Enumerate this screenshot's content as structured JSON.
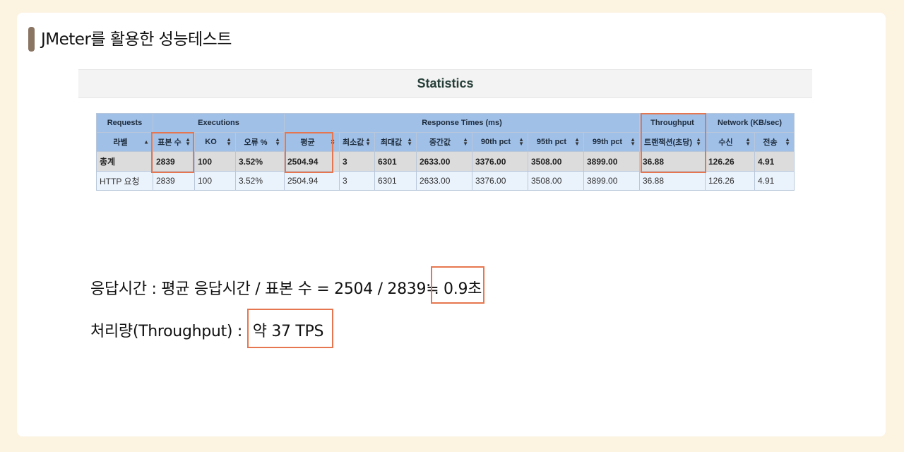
{
  "slide": {
    "title": "JMeter를 활용한 성능테스트"
  },
  "statistics": {
    "title": "Statistics",
    "groups": [
      "Requests",
      "Executions",
      "Response Times (ms)",
      "Throughput",
      "Network (KB/sec)"
    ],
    "columns": [
      "라벨",
      "표본 수",
      "KO",
      "오류 %",
      "평균",
      "최소값",
      "최대값",
      "중간값",
      "90th pct",
      "95th pct",
      "99th pct",
      "트랜잭션(초당)",
      "수신",
      "전송"
    ],
    "rows": [
      [
        "총계",
        "2839",
        "100",
        "3.52%",
        "2504.94",
        "3",
        "6301",
        "2633.00",
        "3376.00",
        "3508.00",
        "3899.00",
        "36.88",
        "126.26",
        "4.91"
      ],
      [
        "HTTP 요청",
        "2839",
        "100",
        "3.52%",
        "2504.94",
        "3",
        "6301",
        "2633.00",
        "3376.00",
        "3508.00",
        "3899.00",
        "36.88",
        "126.26",
        "4.91"
      ]
    ]
  },
  "notes": {
    "line1_prefix": "응답시간 : 평균 응답시간 / 표본 수 = 2504 / 2839",
    "line1_result": "≒ 0.9초",
    "line2_prefix": "처리량(Throughput) : ",
    "line2_result": "약 37 TPS"
  },
  "colors": {
    "highlight": "#e6764f",
    "header_blue": "#a0c0e8",
    "background": "#fcf3e1"
  }
}
